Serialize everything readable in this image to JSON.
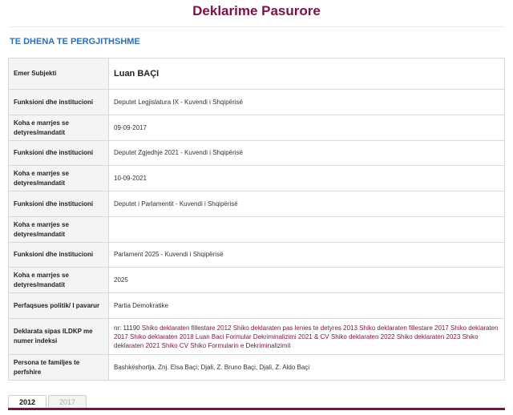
{
  "page": {
    "title": "Deklarime Pasurore"
  },
  "section": {
    "title": "TE DHENA TE PERGJITHSHME"
  },
  "rows": [
    {
      "label": "Emer Subjekti",
      "value": "Luan BAÇI"
    },
    {
      "label": "Funksioni dhe institucioni",
      "value": "Deputet Legjislatura IX - Kuvendi i Shqipërisë"
    },
    {
      "label": "Koha e marrjes se detyres/mandatit",
      "value": "09-09-2017"
    },
    {
      "label": "Funksioni dhe institucioni",
      "value": "Deputet Zgjedhje 2021 - Kuvendi i Shqipërisë"
    },
    {
      "label": "Koha e marrjes se detyres/mandatit",
      "value": "10-09-2021"
    },
    {
      "label": "Funksioni dhe institucioni",
      "value": "Deputet i Parlamentit - Kuvendi i Shqipërisë"
    },
    {
      "label": "Koha e marrjes se detyres/mandatit",
      "value": ""
    },
    {
      "label": "Funksioni dhe institucioni",
      "value": "Parlament 2025 - Kuvendi i Shqipërisë"
    },
    {
      "label": "Koha e marrjes se detyres/mandatit",
      "value": "2025"
    },
    {
      "label": "Perfaqsues politik/ I pavarur",
      "value": "Partia Demokratike"
    },
    {
      "label": "Deklarata sipas ILDKP me numer indeksi",
      "value": ""
    },
    {
      "label": "Persona te familjes te perfshire",
      "value": "Bashkëshortja, Znj. Elsa Baçi; Djali, Z. Bruno Baçi, Djali, Z. Aldo Baçi"
    }
  ],
  "declaration": {
    "prefix": "nr: 11190",
    "links": [
      "Shiko deklaraten fillestare 2012",
      "Shiko deklaraten pas lenies te detyres 2013",
      "Shiko deklaraten fillestare 2017",
      "Shiko deklaraten 2017",
      "Shiko deklaraten 2018",
      "Luan Baci Formular Dekriminalizimi 2021 & CV",
      "Shiko deklaraten 2022",
      "Shiko deklaraten 2023",
      "Shiko deklaraten 2021",
      "Shiko CV",
      "Shiko Formularin e Dekriminalizimit"
    ]
  },
  "tabs": [
    {
      "label": "2012",
      "active": true
    },
    {
      "label": "2017",
      "active": false
    }
  ],
  "colors": {
    "accent": "#7b1245",
    "section": "#2f6fb5",
    "label_bg": "#f4f4f4"
  }
}
